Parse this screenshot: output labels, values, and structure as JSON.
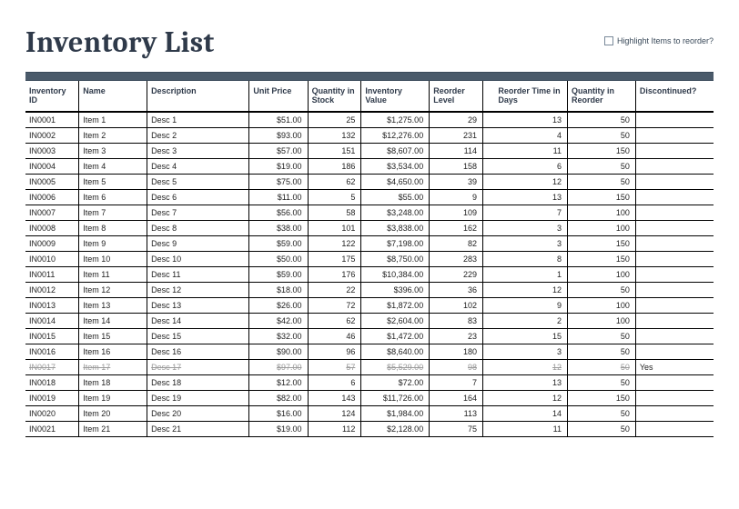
{
  "title": "Inventory List",
  "highlight_label": "Highlight Items to reorder?",
  "columns": {
    "id": "Inventory ID",
    "name": "Name",
    "desc": "Description",
    "price": "Unit Price",
    "qty": "Quantity in Stock",
    "val": "Inventory Value",
    "reord": "Reorder Level",
    "rtime": "Reorder Time in Days",
    "qre": "Quantity in Reorder",
    "disc": "Discontinued?"
  },
  "rows": [
    {
      "id": "IN0001",
      "name": "Item 1",
      "desc": "Desc 1",
      "price": "$51.00",
      "qty": "25",
      "val": "$1,275.00",
      "reord": "29",
      "rtime": "13",
      "qre": "50",
      "disc": ""
    },
    {
      "id": "IN0002",
      "name": "Item 2",
      "desc": "Desc 2",
      "price": "$93.00",
      "qty": "132",
      "val": "$12,276.00",
      "reord": "231",
      "rtime": "4",
      "qre": "50",
      "disc": ""
    },
    {
      "id": "IN0003",
      "name": "Item 3",
      "desc": "Desc 3",
      "price": "$57.00",
      "qty": "151",
      "val": "$8,607.00",
      "reord": "114",
      "rtime": "11",
      "qre": "150",
      "disc": ""
    },
    {
      "id": "IN0004",
      "name": "Item 4",
      "desc": "Desc 4",
      "price": "$19.00",
      "qty": "186",
      "val": "$3,534.00",
      "reord": "158",
      "rtime": "6",
      "qre": "50",
      "disc": ""
    },
    {
      "id": "IN0005",
      "name": "Item 5",
      "desc": "Desc 5",
      "price": "$75.00",
      "qty": "62",
      "val": "$4,650.00",
      "reord": "39",
      "rtime": "12",
      "qre": "50",
      "disc": ""
    },
    {
      "id": "IN0006",
      "name": "Item 6",
      "desc": "Desc 6",
      "price": "$11.00",
      "qty": "5",
      "val": "$55.00",
      "reord": "9",
      "rtime": "13",
      "qre": "150",
      "disc": ""
    },
    {
      "id": "IN0007",
      "name": "Item 7",
      "desc": "Desc 7",
      "price": "$56.00",
      "qty": "58",
      "val": "$3,248.00",
      "reord": "109",
      "rtime": "7",
      "qre": "100",
      "disc": ""
    },
    {
      "id": "IN0008",
      "name": "Item 8",
      "desc": "Desc 8",
      "price": "$38.00",
      "qty": "101",
      "val": "$3,838.00",
      "reord": "162",
      "rtime": "3",
      "qre": "100",
      "disc": ""
    },
    {
      "id": "IN0009",
      "name": "Item 9",
      "desc": "Desc 9",
      "price": "$59.00",
      "qty": "122",
      "val": "$7,198.00",
      "reord": "82",
      "rtime": "3",
      "qre": "150",
      "disc": ""
    },
    {
      "id": "IN0010",
      "name": "Item 10",
      "desc": "Desc 10",
      "price": "$50.00",
      "qty": "175",
      "val": "$8,750.00",
      "reord": "283",
      "rtime": "8",
      "qre": "150",
      "disc": ""
    },
    {
      "id": "IN0011",
      "name": "Item 11",
      "desc": "Desc 11",
      "price": "$59.00",
      "qty": "176",
      "val": "$10,384.00",
      "reord": "229",
      "rtime": "1",
      "qre": "100",
      "disc": ""
    },
    {
      "id": "IN0012",
      "name": "Item 12",
      "desc": "Desc 12",
      "price": "$18.00",
      "qty": "22",
      "val": "$396.00",
      "reord": "36",
      "rtime": "12",
      "qre": "50",
      "disc": ""
    },
    {
      "id": "IN0013",
      "name": "Item 13",
      "desc": "Desc 13",
      "price": "$26.00",
      "qty": "72",
      "val": "$1,872.00",
      "reord": "102",
      "rtime": "9",
      "qre": "100",
      "disc": ""
    },
    {
      "id": "IN0014",
      "name": "Item 14",
      "desc": "Desc 14",
      "price": "$42.00",
      "qty": "62",
      "val": "$2,604.00",
      "reord": "83",
      "rtime": "2",
      "qre": "100",
      "disc": ""
    },
    {
      "id": "IN0015",
      "name": "Item 15",
      "desc": "Desc 15",
      "price": "$32.00",
      "qty": "46",
      "val": "$1,472.00",
      "reord": "23",
      "rtime": "15",
      "qre": "50",
      "disc": ""
    },
    {
      "id": "IN0016",
      "name": "Item 16",
      "desc": "Desc 16",
      "price": "$90.00",
      "qty": "96",
      "val": "$8,640.00",
      "reord": "180",
      "rtime": "3",
      "qre": "50",
      "disc": ""
    },
    {
      "id": "IN0017",
      "name": "Item 17",
      "desc": "Desc 17",
      "price": "$97.00",
      "qty": "57",
      "val": "$5,529.00",
      "reord": "98",
      "rtime": "12",
      "qre": "50",
      "disc": "Yes",
      "discontinued": true
    },
    {
      "id": "IN0018",
      "name": "Item 18",
      "desc": "Desc 18",
      "price": "$12.00",
      "qty": "6",
      "val": "$72.00",
      "reord": "7",
      "rtime": "13",
      "qre": "50",
      "disc": ""
    },
    {
      "id": "IN0019",
      "name": "Item 19",
      "desc": "Desc 19",
      "price": "$82.00",
      "qty": "143",
      "val": "$11,726.00",
      "reord": "164",
      "rtime": "12",
      "qre": "150",
      "disc": ""
    },
    {
      "id": "IN0020",
      "name": "Item 20",
      "desc": "Desc 20",
      "price": "$16.00",
      "qty": "124",
      "val": "$1,984.00",
      "reord": "113",
      "rtime": "14",
      "qre": "50",
      "disc": ""
    },
    {
      "id": "IN0021",
      "name": "Item 21",
      "desc": "Desc 21",
      "price": "$19.00",
      "qty": "112",
      "val": "$2,128.00",
      "reord": "75",
      "rtime": "11",
      "qre": "50",
      "disc": ""
    }
  ]
}
